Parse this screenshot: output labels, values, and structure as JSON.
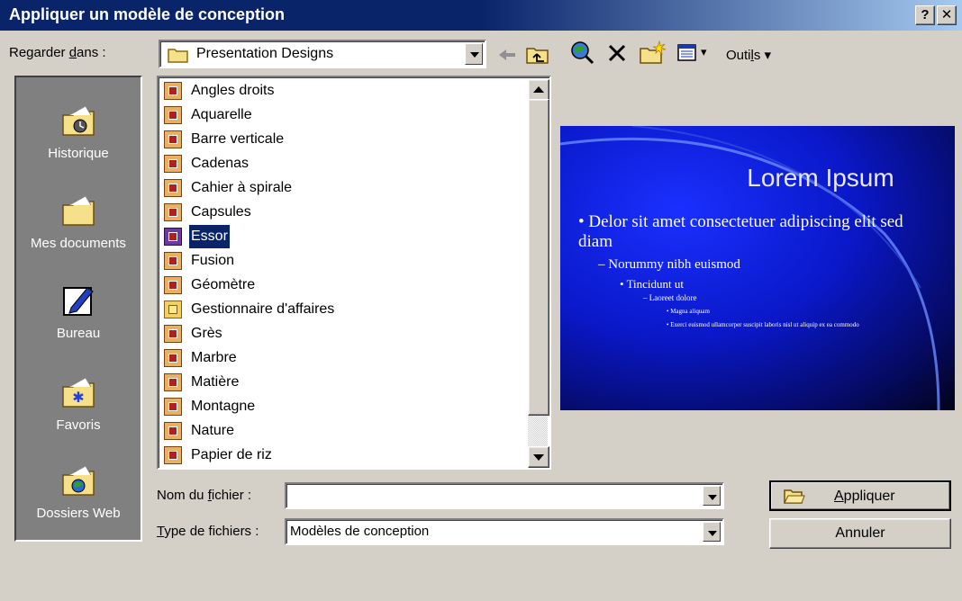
{
  "window": {
    "title": "Appliquer un modèle de conception",
    "help_label": "?",
    "close_label": "✕"
  },
  "lookin": {
    "label_pre": "Regarder ",
    "label_u": "d",
    "label_post": "ans :",
    "value": "Presentation Designs"
  },
  "toolbar": {
    "tools_pre": "Outi",
    "tools_u": "l",
    "tools_post": "s ▾",
    "views_arrow": "▾"
  },
  "places": [
    {
      "label": "Historique",
      "icon": "history-folder-icon"
    },
    {
      "label": "Mes documents",
      "icon": "my-documents-folder-icon"
    },
    {
      "label": "Bureau",
      "icon": "desktop-icon"
    },
    {
      "label": "Favoris",
      "icon": "favorites-folder-icon"
    },
    {
      "label": "Dossiers Web",
      "icon": "web-folders-icon"
    }
  ],
  "files": [
    {
      "name": "Angles droits",
      "type": "design"
    },
    {
      "name": "Aquarelle",
      "type": "design"
    },
    {
      "name": "Barre verticale",
      "type": "design"
    },
    {
      "name": "Cadenas",
      "type": "design"
    },
    {
      "name": "Cahier à spirale",
      "type": "design"
    },
    {
      "name": "Capsules",
      "type": "design"
    },
    {
      "name": "Essor",
      "type": "design",
      "selected": true
    },
    {
      "name": "Fusion",
      "type": "design"
    },
    {
      "name": "Géomètre",
      "type": "design"
    },
    {
      "name": "Gestionnaire d'affaires",
      "type": "folder"
    },
    {
      "name": "Grès",
      "type": "design"
    },
    {
      "name": "Marbre",
      "type": "design"
    },
    {
      "name": "Matière",
      "type": "design"
    },
    {
      "name": "Montagne",
      "type": "design"
    },
    {
      "name": "Nature",
      "type": "design"
    },
    {
      "name": "Papier de riz",
      "type": "design"
    }
  ],
  "preview": {
    "title": "Lorem Ipsum",
    "bullet1": "• Delor sit amet consectetuer adipiscing elit sed diam",
    "bullet2": "– Norummy nibh euismod",
    "bullet3": "• Tincidunt ut",
    "bullet4": "– Laoreet dolore",
    "bullet5": "• Magna aliquam",
    "bullet6": "• Exerci euismod ullamcorper suscipit laboris nisl ut aliquip ex ea commodo"
  },
  "filename": {
    "label_pre": "Nom du ",
    "label_u": "f",
    "label_post": "ichier :",
    "value": ""
  },
  "filetype": {
    "label_u": "T",
    "label_post": "ype de fichiers :",
    "value": "Modèles de conception"
  },
  "buttons": {
    "apply_u": "A",
    "apply_post": "ppliquer",
    "cancel": "Annuler"
  }
}
